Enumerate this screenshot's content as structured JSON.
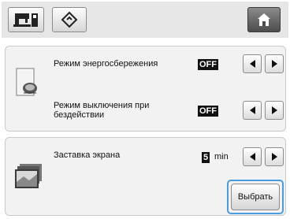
{
  "toolbar": {
    "icons": [
      "sewing-machine-icon",
      "embroidery-diamond-icon",
      "home-icon"
    ]
  },
  "power_settings": {
    "eco_mode": {
      "label": "Режим энергосбережения",
      "value": "OFF"
    },
    "shutoff_mode": {
      "label_line1": "Режим выключения при",
      "label_line2": "бездействии",
      "value": "OFF"
    }
  },
  "screen_saver": {
    "label": "Заставка экрана",
    "value": "5",
    "unit": "min",
    "select_button": "Выбрать"
  },
  "colors": {
    "highlight": "#4a9be0",
    "value_box_bg": "#111111",
    "panel_bg": "#f2f2f2",
    "toolbar_bg": "#e6e6e6"
  }
}
